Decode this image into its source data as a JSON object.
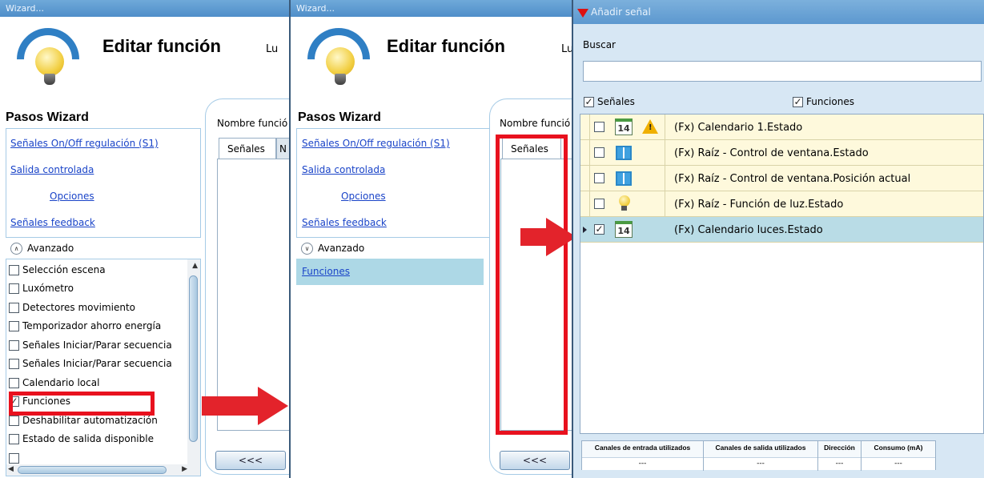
{
  "panel1": {
    "window_title": "Wizard...",
    "header_title": "Editar función",
    "header_cut": "Lu",
    "steps_title": "Pasos Wizard",
    "steps": [
      "Señales On/Off regulación (S1)",
      "Salida controlada",
      "Opciones",
      "Señales feedback"
    ],
    "advanced_label": "Avanzado",
    "advanced_items": [
      {
        "label": "Selección escena",
        "checked": false,
        "mark": ""
      },
      {
        "label": "Luxómetro",
        "checked": false,
        "mark": ""
      },
      {
        "label": "Detectores movimiento",
        "checked": false,
        "mark": ""
      },
      {
        "label": "Temporizador ahorro energía",
        "checked": false,
        "mark": ""
      },
      {
        "label": "Señales Iniciar/Parar secuencia",
        "checked": false,
        "mark": ""
      },
      {
        "label": "Señales Iniciar/Parar secuencia",
        "checked": false,
        "mark": ""
      },
      {
        "label": "Calendario local",
        "checked": false,
        "mark": ""
      },
      {
        "label": "Funciones",
        "checked": true,
        "mark": "✓"
      },
      {
        "label": "Deshabilitar automatización",
        "checked": false,
        "mark": ""
      },
      {
        "label": "Estado de salida disponible",
        "checked": false,
        "mark": ""
      }
    ],
    "nombre_label": "Nombre funció",
    "tab_signals": "Señales",
    "tab_next": "N",
    "back_button": "<<<"
  },
  "panel2": {
    "window_title": "Wizard...",
    "header_title": "Editar función",
    "header_cut": "Lu",
    "steps_title": "Pasos Wizard",
    "steps": [
      "Señales On/Off regulación (S1)",
      "Salida controlada",
      "Opciones",
      "Señales feedback"
    ],
    "advanced_label": "Avanzado",
    "advanced_items": [
      "Funciones"
    ],
    "nombre_label": "Nombre funció",
    "tab_signals": "Señales",
    "back_button": "<<<"
  },
  "dialog": {
    "title": "Añadir señal",
    "search_label": "Buscar",
    "search_value": "",
    "filter_signals": {
      "label": "Señales",
      "checked": true
    },
    "filter_functions": {
      "label": "Funciones",
      "checked": true
    },
    "rows": [
      {
        "text": "(Fx) Calendario 1.Estado",
        "checked": false,
        "mark": "",
        "icon": "calendar-icon",
        "icon_text": "14",
        "warning": true,
        "selected": false
      },
      {
        "text": "(Fx) Raíz - Control de ventana.Estado",
        "checked": false,
        "mark": "",
        "icon": "window-icon",
        "icon_text": "",
        "warning": false,
        "selected": false
      },
      {
        "text": "(Fx) Raíz - Control de ventana.Posición actual",
        "checked": false,
        "mark": "",
        "icon": "window-icon",
        "icon_text": "",
        "warning": false,
        "selected": false
      },
      {
        "text": "(Fx) Raíz - Función de luz.Estado",
        "checked": false,
        "mark": "",
        "icon": "bulb-icon",
        "icon_text": "",
        "warning": false,
        "selected": false
      },
      {
        "text": "(Fx) Calendario luces.Estado",
        "checked": true,
        "mark": "✓",
        "icon": "calendar-icon",
        "icon_text": "14",
        "warning": false,
        "selected": true
      }
    ],
    "footer": {
      "headers": [
        "Canales de entrada utilizados",
        "Canales de salida utilizados",
        "Dirección",
        "Consumo (mA)"
      ],
      "values": [
        "---",
        "---",
        "---",
        "---"
      ]
    },
    "warning_mark": "!",
    "check_mark": "✓"
  },
  "colors": {
    "accent_red": "#e3232b",
    "title_blue": "#5c98cf",
    "link_blue": "#1a44c8",
    "row_yellow": "#fef9dc",
    "row_selected": "#b9dce6"
  }
}
